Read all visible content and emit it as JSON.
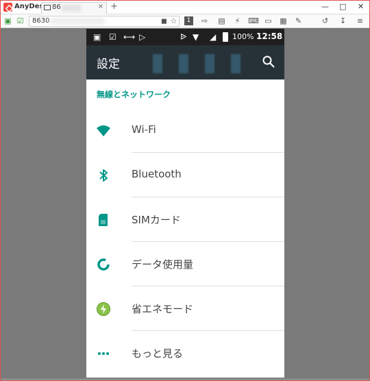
{
  "window": {
    "app_name": "AnyDesk",
    "tab_label": "86",
    "tab_close": "×",
    "tab_add": "+",
    "address_value": "8630"
  },
  "statusbar": {
    "battery_percent": "100%",
    "time": "12:58"
  },
  "appbar": {
    "title": "設定"
  },
  "section": {
    "header": "無線とネットワーク"
  },
  "items": [
    {
      "label": "Wi-Fi",
      "icon": "wifi-icon"
    },
    {
      "label": "Bluetooth",
      "icon": "bluetooth-icon"
    },
    {
      "label": "SIMカード",
      "icon": "sim-card-icon"
    },
    {
      "label": "データ使用量",
      "icon": "data-usage-icon"
    },
    {
      "label": "省エネモード",
      "icon": "battery-saver-icon"
    },
    {
      "label": "もっと見る",
      "icon": "more-dots-icon"
    }
  ],
  "colors": {
    "accent": "#009688",
    "appbar": "#273238",
    "statusbar": "#1f1f1f",
    "anydesk_red": "#ef443b"
  }
}
